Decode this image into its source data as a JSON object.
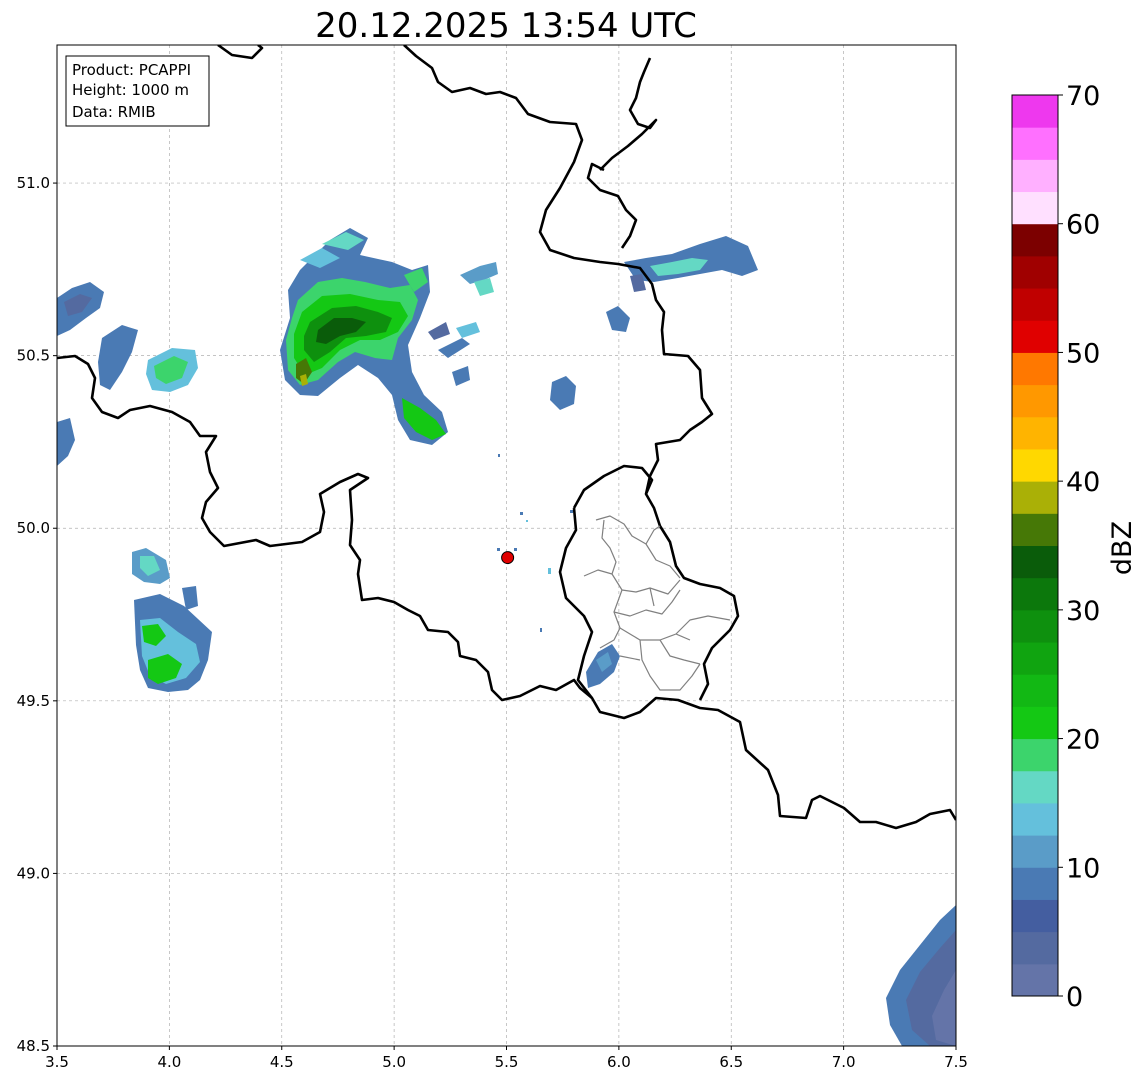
{
  "title": "20.12.2025 13:54 UTC",
  "info_box": {
    "line1": "Product: PCAPPI",
    "line2": "Height: 1000 m",
    "line3": "Data: RMIB"
  },
  "map": {
    "lon_range": [
      3.5,
      7.5
    ],
    "lat_range": [
      48.5,
      51.4
    ],
    "lon_ticks": [
      3.5,
      4.0,
      4.5,
      5.0,
      5.5,
      6.0,
      6.5,
      7.0,
      7.5
    ],
    "lat_ticks": [
      48.5,
      49.0,
      49.5,
      50.0,
      50.5,
      51.0
    ],
    "lon_tick_labels": [
      "3.5",
      "4.0",
      "4.5",
      "5.0",
      "5.5",
      "6.0",
      "6.5",
      "7.0",
      "7.5"
    ],
    "lat_tick_labels": [
      "48.5",
      "49.0",
      "49.5",
      "50.0",
      "50.5",
      "51.0"
    ],
    "grid": true,
    "radar_site": {
      "lon": 5.505,
      "lat": 49.915,
      "color": "#e00000"
    }
  },
  "colorbar": {
    "label": "dBZ",
    "range": [
      0,
      70
    ],
    "step": 2.5,
    "tick_values": [
      0,
      10,
      20,
      30,
      40,
      50,
      60,
      70
    ],
    "tick_labels": [
      "0",
      "10",
      "20",
      "30",
      "40",
      "50",
      "60",
      "70"
    ],
    "colors": [
      "#6474a8",
      "#546aa0",
      "#445ea0",
      "#4a7ab4",
      "#5a9cc8",
      "#64c0dc",
      "#64d8c4",
      "#3cd46c",
      "#14c814",
      "#12b814",
      "#10a410",
      "#0e900e",
      "#0c780c",
      "#0a5c0a",
      "#467806",
      "#aab006",
      "#ffd800",
      "#ffb400",
      "#ff9800",
      "#ff7800",
      "#e00000",
      "#c00000",
      "#a00000",
      "#7c0000",
      "#ffe0ff",
      "#ffb0ff",
      "#ff70ff",
      "#ee38ee"
    ]
  },
  "colors": {
    "border": "#000000",
    "district_border": "#808080",
    "grid": "#b0b0b0"
  }
}
